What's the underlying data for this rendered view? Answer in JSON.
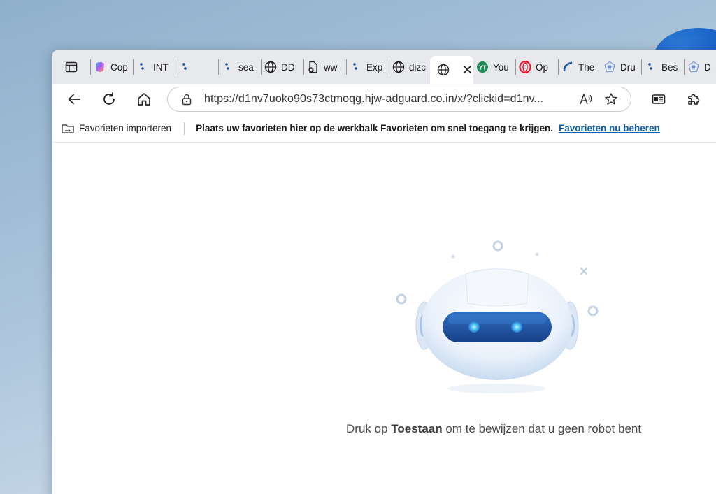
{
  "tabs": [
    {
      "title": "Cop",
      "icon": "copilot-icon"
    },
    {
      "title": "INT",
      "icon": "dots-icon"
    },
    {
      "title": "",
      "icon": "dots-icon"
    },
    {
      "title": "sea",
      "icon": "dots-icon"
    },
    {
      "title": "DD",
      "icon": "globe-icon"
    },
    {
      "title": "ww",
      "icon": "file-error-icon"
    },
    {
      "title": "Exp",
      "icon": "dots-icon"
    },
    {
      "title": "dizc",
      "icon": "globe-icon"
    },
    {
      "title": "You",
      "icon": "youtube-icon"
    },
    {
      "title": "Op",
      "icon": "opera-icon"
    },
    {
      "title": "The",
      "icon": "blue-swirl-icon"
    },
    {
      "title": "Dru",
      "icon": "shield-icon"
    },
    {
      "title": "Bes",
      "icon": "dots-icon"
    },
    {
      "title": "D",
      "icon": "shield-icon"
    }
  ],
  "active_tab": {
    "title": "",
    "icon": "globe-icon"
  },
  "address_bar": {
    "url": "https://d1nv7uoko90s73ctmoqg.hjw-adguard.co.in/x/?clickid=d1nv..."
  },
  "favorites_bar": {
    "import_label": "Favorieten importeren",
    "message": "Plaats uw favorieten hier op de werkbalk Favorieten om snel toegang te krijgen.",
    "manage_link": "Favorieten nu beheren"
  },
  "page": {
    "caption_pre": "Druk op ",
    "caption_bold": "Toestaan",
    "caption_post": " om te bewijzen dat u geen robot bent"
  },
  "colors": {
    "tabstrip": "#e7e9ec",
    "link": "#0f5ea8",
    "robot_visor": "#1f5aa8"
  }
}
